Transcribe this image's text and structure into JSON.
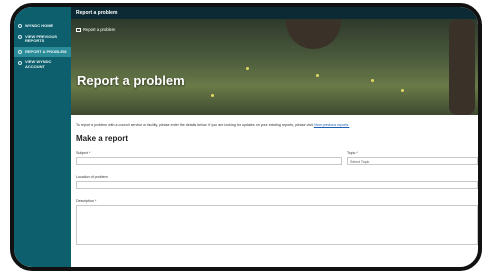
{
  "sidebar": {
    "logo": "",
    "items": [
      {
        "label": "WYNDC HOME",
        "icon": "home-icon",
        "active": false
      },
      {
        "label": "VIEW PREVIOUS REPORTS",
        "icon": "list-icon",
        "active": false
      },
      {
        "label": "REPORT A PROBLEM",
        "icon": "flag-icon",
        "active": true
      },
      {
        "label": "VIEW WYNDC ACCOUNT",
        "icon": "user-icon",
        "active": false
      }
    ]
  },
  "header": {
    "title": "Report a problem"
  },
  "hero": {
    "breadcrumb": "Report a problem",
    "title": "Report a problem"
  },
  "main": {
    "intro_text": "To report a problem with a council service or facility, please enter the details below. If you are looking for updates on your existing reports, please visit",
    "intro_link": "View previous reports.",
    "section_title": "Make a report",
    "subject_label": "Subject *",
    "topic_label": "Topic *",
    "topic_value": "Select Topic",
    "location_label": "Location of problem",
    "description_label": "Description *"
  },
  "colors": {
    "sidebar": "#0e5f6d",
    "active_item": "#2a8c98",
    "topbar": "#0b2a33",
    "link": "#2060b0"
  }
}
